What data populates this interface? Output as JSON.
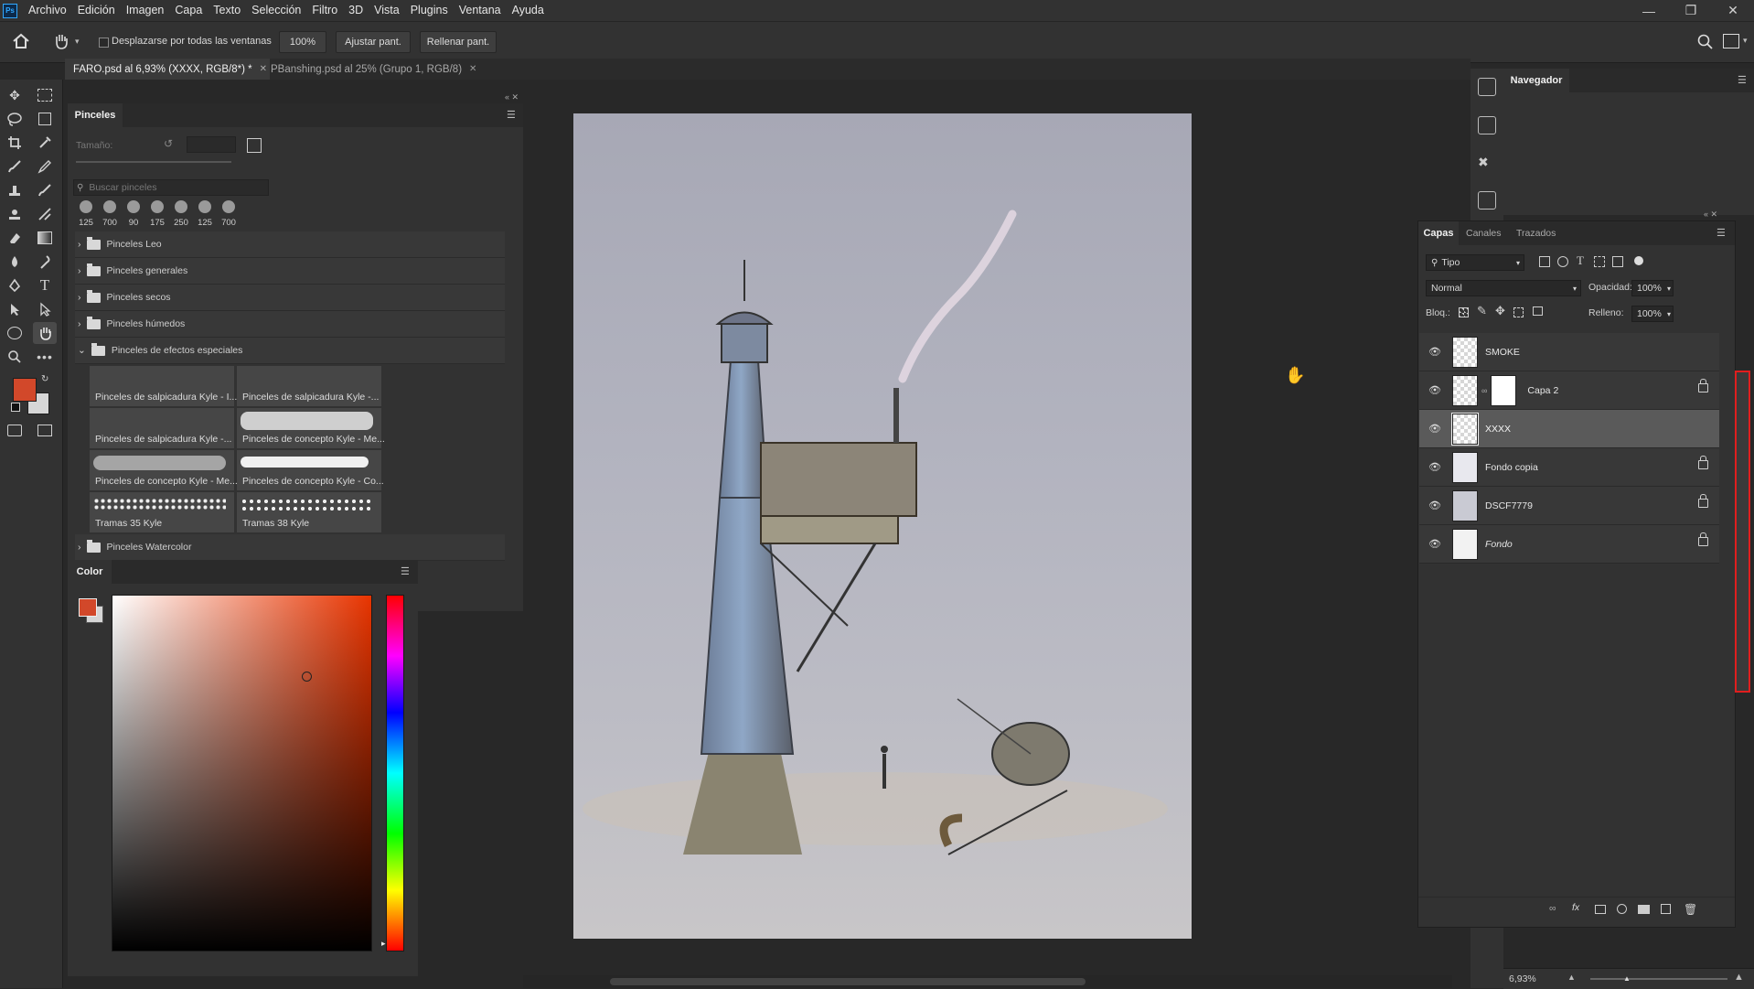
{
  "app": {
    "logo": "Ps"
  },
  "menu": [
    "Archivo",
    "Edición",
    "Imagen",
    "Capa",
    "Texto",
    "Selección",
    "Filtro",
    "3D",
    "Vista",
    "Plugins",
    "Ventana",
    "Ayuda"
  ],
  "options": {
    "scroll_all_label": "Desplazarse por todas las ventanas",
    "zoom_value": "100%",
    "fit_screen": "Ajustar pant.",
    "fill_screen": "Rellenar pant."
  },
  "tabs": [
    {
      "label": "FARO.psd al 6,93% (XXXX, RGB/8*) *",
      "active": true
    },
    {
      "label": "PBanshing.psd al 25% (Grupo 1, RGB/8)",
      "active": false
    }
  ],
  "brushes": {
    "title": "Pinceles",
    "size_label": "Tamaño:",
    "search_placeholder": "Buscar pinceles",
    "recent_sizes": [
      "125",
      "700",
      "90",
      "175",
      "250",
      "125",
      "700"
    ],
    "folders": [
      "Pinceles Leo",
      "Pinceles generales",
      "Pinceles secos",
      "Pinceles húmedos",
      "Pinceles de efectos especiales"
    ],
    "presets": [
      "Pinceles de salpicadura Kyle - I...",
      "Pinceles de salpicadura Kyle -...",
      "Pinceles de salpicadura Kyle -...",
      "Pinceles de concepto Kyle - Me...",
      "Pinceles de concepto Kyle - Me...",
      "Pinceles de concepto Kyle - Co...",
      "Tramas 35 Kyle",
      "Tramas 38 Kyle"
    ],
    "last_folder": "Pinceles Watercolor"
  },
  "color_panel": {
    "title": "Color",
    "foreground": "#d2482a",
    "background": "#d6d6d6"
  },
  "navigator": {
    "title": "Navegador"
  },
  "layers_panel": {
    "tabs": [
      "Capas",
      "Canales",
      "Trazados"
    ],
    "filter_type": "Tipo",
    "blend_mode": "Normal",
    "opacity_label": "Opacidad:",
    "opacity_value": "100%",
    "lock_label": "Bloq.:",
    "fill_label": "Relleno:",
    "fill_value": "100%",
    "layers": [
      {
        "name": "SMOKE",
        "locked": false,
        "selected": false
      },
      {
        "name": "Capa 2",
        "locked": true,
        "selected": false
      },
      {
        "name": "XXXX",
        "locked": false,
        "selected": true
      },
      {
        "name": "Fondo copia",
        "locked": true,
        "selected": false
      },
      {
        "name": "DSCF7779",
        "locked": true,
        "selected": false
      },
      {
        "name": "Fondo",
        "locked": true,
        "selected": false
      }
    ]
  },
  "status": {
    "zoom": "6,93%"
  }
}
